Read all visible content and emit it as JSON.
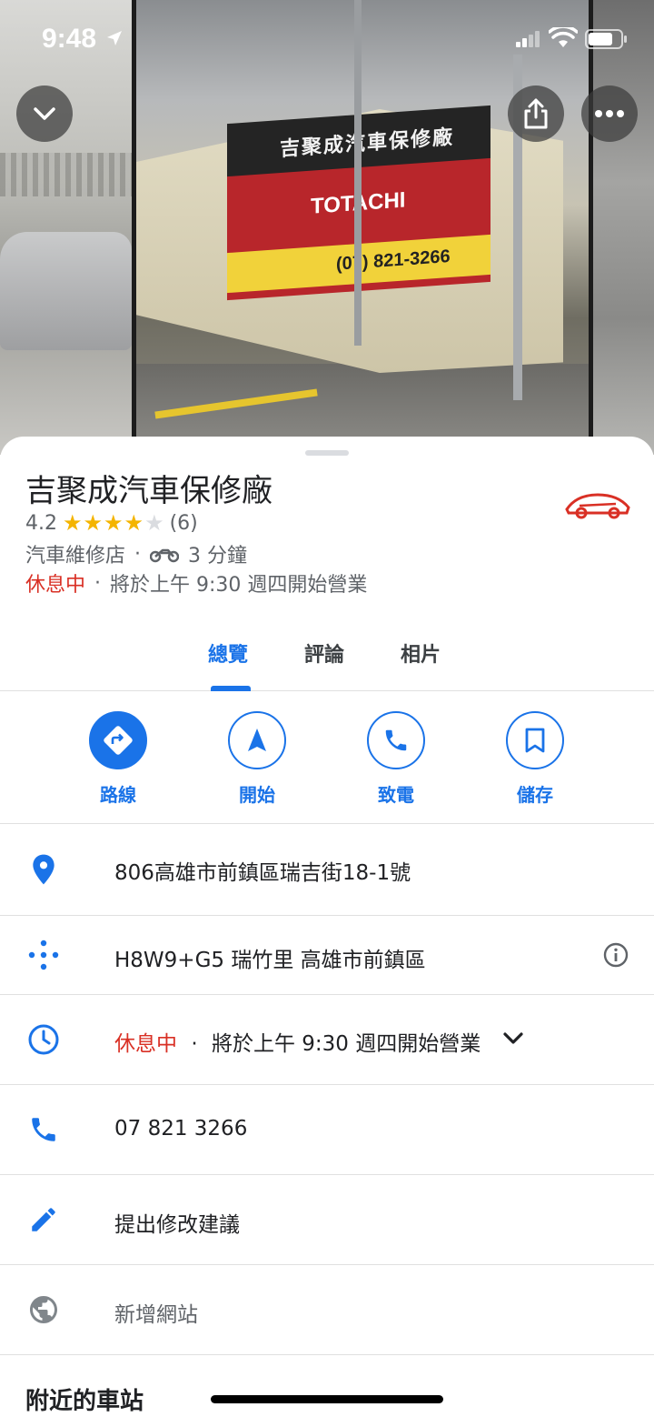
{
  "status_bar": {
    "time": "9:48"
  },
  "photo_sign": {
    "brand": "TOTACHI",
    "phone": "(07) 821-3266",
    "shop_name": "吉聚成汽車保修廠"
  },
  "place": {
    "name": "吉聚成汽車保修廠",
    "rating": "4.2",
    "rating_value": 4.2,
    "review_count": "(6)",
    "category": "汽車維修店",
    "travel_time": "3 分鐘",
    "status": "休息中",
    "next_open": "將於上午 9:30 週四開始營業"
  },
  "tabs": [
    {
      "label": "總覽",
      "active": true
    },
    {
      "label": "評論",
      "active": false
    },
    {
      "label": "相片",
      "active": false
    }
  ],
  "actions": [
    {
      "label": "路線",
      "icon": "directions-icon"
    },
    {
      "label": "開始",
      "icon": "navigation-arrow-icon"
    },
    {
      "label": "致電",
      "icon": "phone-icon"
    },
    {
      "label": "儲存",
      "icon": "bookmark-icon"
    }
  ],
  "info": {
    "address": "806高雄市前鎮區瑞吉街18-1號",
    "plus_code": "H8W9+G5 瑞竹里 高雄市前鎮區",
    "hours_status": "休息中",
    "hours_next": "將於上午 9:30 週四開始營業",
    "phone": "07 821 3266",
    "suggest_edit": "提出修改建議",
    "add_website": "新增網站"
  },
  "nearby": {
    "title": "附近的車站"
  },
  "colors": {
    "accent": "#1a73e8",
    "closed": "#d93025",
    "star": "#f4b400"
  }
}
